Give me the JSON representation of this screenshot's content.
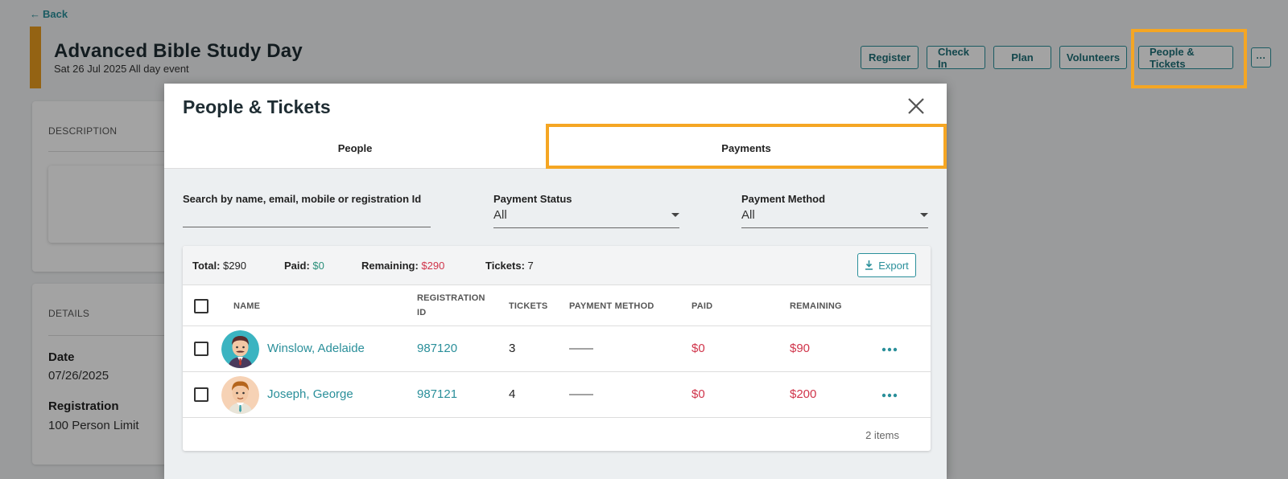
{
  "back": {
    "label": "Back"
  },
  "event": {
    "title": "Advanced Bible Study Day",
    "date_line": "Sat 26 Jul  2025  All day event"
  },
  "top_actions": [
    "Register",
    "Check In",
    "Plan",
    "Volunteers",
    "People & Tickets",
    "···"
  ],
  "sidebar_cards": {
    "description_heading": "DESCRIPTION",
    "details_heading": "DETAILS",
    "date_label": "Date",
    "date_value": "07/26/2025",
    "registration_label": "Registration",
    "registration_value": "100 Person Limit"
  },
  "modal": {
    "title": "People & Tickets",
    "tabs": [
      "People",
      "Payments"
    ],
    "active_tab": "Payments",
    "filters": {
      "search_label": "Search by name, email, mobile or registration Id",
      "search_value": "",
      "status_label": "Payment Status",
      "status_value": "All",
      "method_label": "Payment Method",
      "method_value": "All"
    },
    "summary": {
      "total_label": "Total:",
      "total_value": "$290",
      "paid_label": "Paid:",
      "paid_value": "$0",
      "remaining_label": "Remaining:",
      "remaining_value": "$290",
      "tickets_label": "Tickets:",
      "tickets_value": "7",
      "export_label": "Export"
    },
    "columns": {
      "name": "NAME",
      "registration_1": "REGISTRATION",
      "registration_2": "ID",
      "tickets": "TICKETS",
      "payment_method": "PAYMENT METHOD",
      "paid": "PAID",
      "remaining": "REMAINING"
    },
    "rows": [
      {
        "name": "Winslow, Adelaide",
        "registration_id": "987120",
        "tickets": "3",
        "payment_method": "——",
        "paid": "$0",
        "remaining": "$90"
      },
      {
        "name": "Joseph, George",
        "registration_id": "987121",
        "tickets": "4",
        "payment_method": "——",
        "paid": "$0",
        "remaining": "$200"
      }
    ],
    "item_count": "2 items"
  },
  "colors": {
    "accent": "#e89b1e",
    "teal": "#2a8f9a",
    "highlight": "#f5a623",
    "negative": "#d0344a",
    "positive": "#2a8f7a"
  },
  "icons": [
    "back-arrow-icon",
    "close-icon",
    "download-icon",
    "more-horizontal-icon",
    "chevron-down-icon"
  ]
}
